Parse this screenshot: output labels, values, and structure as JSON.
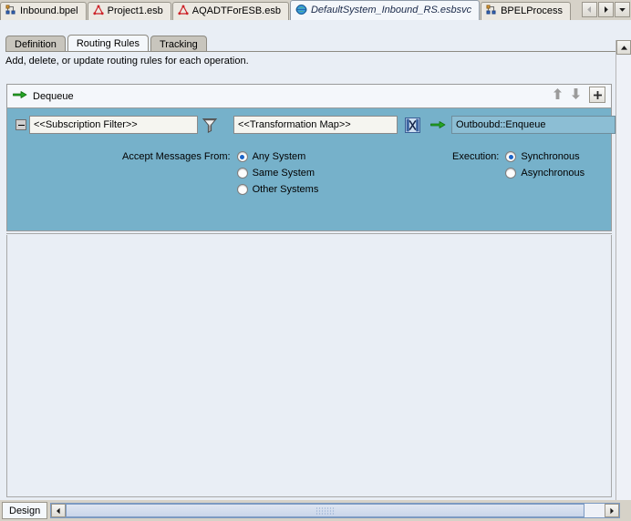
{
  "window": {
    "editor_tabs": [
      {
        "label": "Inbound.bpel",
        "icon": "bpel-file-icon",
        "active": false
      },
      {
        "label": "Project1.esb",
        "icon": "esb-file-icon",
        "active": false
      },
      {
        "label": "AQADTForESB.esb",
        "icon": "esb-file-icon",
        "active": false
      },
      {
        "label": "DefaultSystem_Inbound_RS.esbsvc",
        "icon": "globe-service-icon",
        "active": true
      },
      {
        "label": "BPELProcess",
        "icon": "bpel-file-icon",
        "active": false
      }
    ],
    "tab_nav": {
      "prev_label": "◀",
      "next_label": "▶",
      "list_label": "▼"
    }
  },
  "subtabs": [
    {
      "label": "Definition",
      "active": false
    },
    {
      "label": "Routing Rules",
      "active": true
    },
    {
      "label": "Tracking",
      "active": false
    }
  ],
  "hint": "Add, delete, or update routing rules for each operation.",
  "rule": {
    "title": "Dequeue",
    "title_icon": "green-arrow-icon",
    "header_actions": {
      "move_up": "⬆",
      "move_down": "⬇",
      "add_label": "+"
    },
    "collapse_label": "−",
    "subscription_filter": "<<Subscription Filter>>",
    "subscription_filter_placeholder": "<<Subscription Filter>>",
    "filter_icon": "funnel-icon",
    "transformation_map": "<<Transformation Map>>",
    "transformation_map_placeholder": "<<Transformation Map>>",
    "transform_icon": "transformation-map-icon",
    "flow_arrow_icon": "green-arrow-icon",
    "output_target": "Outboubd::Enqueue"
  },
  "accept_messages": {
    "caption": "Accept Messages From:",
    "options": [
      {
        "label": "Any System",
        "selected": true
      },
      {
        "label": "Same System",
        "selected": false
      },
      {
        "label": "Other Systems",
        "selected": false
      }
    ]
  },
  "execution": {
    "caption": "Execution:",
    "options": [
      {
        "label": "Synchronous",
        "selected": true
      },
      {
        "label": "Asynchronous",
        "selected": false
      }
    ]
  },
  "bottom": {
    "design_tab": "Design",
    "hscroll_left": "◀",
    "hscroll_right": "▶"
  },
  "colors": {
    "panel_blue": "#76b1ca",
    "accent_green": "#1ca51c",
    "selected_radio": "#1b64c8",
    "tabstrip": "#d6d2c8",
    "canvas": "#e9eef5"
  }
}
